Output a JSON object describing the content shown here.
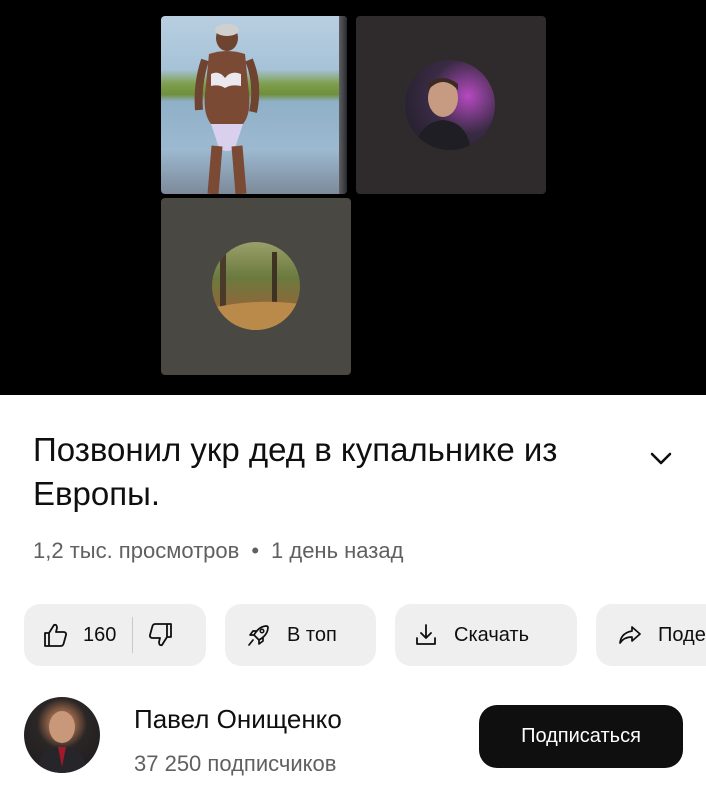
{
  "video": {
    "tiles": [
      {
        "name": "main-participant",
        "icon": "person-in-swimsuit"
      },
      {
        "name": "participant-2",
        "icon": "man-avatar"
      },
      {
        "name": "participant-3",
        "icon": "forest-avatar"
      }
    ]
  },
  "title": "Позвонил укр дед в купальнике из Европы.",
  "meta": {
    "views": "1,2 тыс. просмотров",
    "separator": "•",
    "age": "1 день назад"
  },
  "actions": {
    "like_count": "160",
    "top_label": "В топ",
    "download_label": "Скачать",
    "share_label": "Поде"
  },
  "channel": {
    "name": "Павел Онищенко",
    "subscribers": "37 250 подписчиков",
    "subscribe_label": "Подписаться"
  },
  "icons": {
    "like": "thumbs-up-icon",
    "dislike": "thumbs-down-icon",
    "top": "rocket-icon",
    "download": "download-icon",
    "share": "share-icon",
    "expand": "chevron-down-icon"
  },
  "colors": {
    "background": "#ffffff",
    "pill": "#efefef",
    "subscribe_bg": "#0f0f0f",
    "secondary_text": "#606060"
  }
}
